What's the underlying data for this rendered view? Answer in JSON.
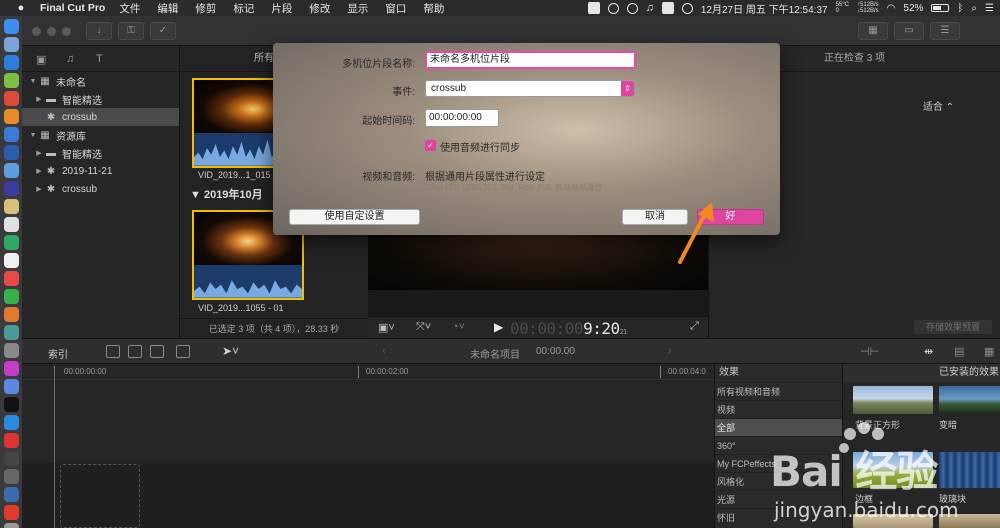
{
  "menubar": {
    "app_name": "Final Cut Pro",
    "items": [
      "文件",
      "编辑",
      "修剪",
      "标记",
      "片段",
      "修改",
      "显示",
      "窗口",
      "帮助"
    ],
    "temp": "55°C",
    "temp_sub": "0",
    "net_up": "↑512B/s",
    "net_down": "↓512B/s",
    "datetime": "12月27日 周五 下午12:54:37",
    "battery": "52%"
  },
  "library": {
    "items": [
      {
        "label": "未命名",
        "level": 0,
        "icon": "library-icon"
      },
      {
        "label": "智能精选",
        "level": 1,
        "icon": "folder-icon"
      },
      {
        "label": "crossub",
        "level": 1,
        "icon": "event-star-icon",
        "selected": true
      },
      {
        "label": "资源库",
        "level": 0,
        "icon": "library-icon"
      },
      {
        "label": "智能精选",
        "level": 1,
        "icon": "folder-icon"
      },
      {
        "label": "2019-11-21",
        "level": 1,
        "icon": "event-star-icon"
      },
      {
        "label": "crossub",
        "level": 1,
        "icon": "event-star-icon"
      }
    ]
  },
  "browser": {
    "header": "所有片段",
    "clip1_name": "VID_2019...1_015",
    "date_group": "2019年10月",
    "clip2_name": "VID_2019...1055 - 01",
    "status": "已选定 3 项（共 4 项），28.33 秒"
  },
  "viewer": {
    "timecode_dim": "00:00:00",
    "timecode_on": "9:20",
    "timecode_sub": "21"
  },
  "inspector": {
    "header": "正在检查 3 项",
    "fit_label": "适合 ⌃",
    "save_label": "存储效果预置"
  },
  "timeline_bar": {
    "index_label": "索引",
    "project_name": "未命名项目",
    "project_time": "00:00.00"
  },
  "ruler": {
    "ticks": [
      "00:00:00:00",
      "00:00:02:00",
      "00:00:04:0"
    ]
  },
  "effects": {
    "title": "效果",
    "installed_label": "已安装的效果",
    "categories": [
      "所有视频和音频",
      "视频",
      "全部",
      "360°",
      "My FCPeffects",
      "风格化",
      "光源",
      "怀旧"
    ],
    "selected_category": "全部",
    "thumbs": [
      "背景正方形",
      "变暗",
      "边框",
      "玻璃块"
    ]
  },
  "dialog": {
    "name_label": "多机位片段名称:",
    "name_value": "未命名多机位片段",
    "event_label": "事件:",
    "event_value": "crossub",
    "start_label": "起始时间码:",
    "start_value": "00:00:00:00",
    "sync_label": "使用音频进行同步",
    "av_label": "视频和音频:",
    "av_value": "根据通用片段属性进行设定",
    "av_sub": "720p HD, 1280x720, 30p, Rec. 709, 自动音频属性",
    "custom_button": "使用自定设置",
    "cancel_button": "取消",
    "ok_button": "好"
  },
  "watermark": {
    "main": "Bai 经验",
    "sub": "jingyan.baidu.com"
  },
  "colors": {
    "accent": "#e0449f",
    "selection": "#f0c000",
    "annotation": "#f08a1e"
  }
}
